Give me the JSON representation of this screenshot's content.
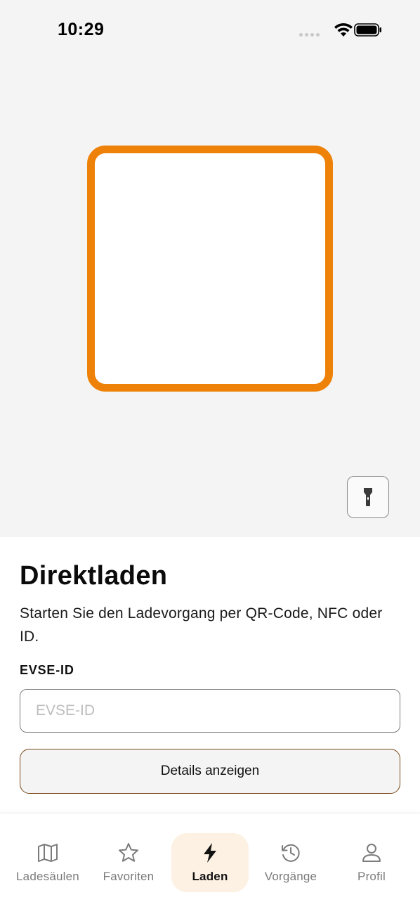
{
  "status_bar": {
    "time": "10:29"
  },
  "scanner": {
    "frame_color": "#ee8208",
    "torch_icon": "flashlight-icon"
  },
  "panel": {
    "title": "Direktladen",
    "subtitle": "Starten Sie den Ladevorgang per QR-Code, NFC oder ID.",
    "evse_label": "EVSE-ID",
    "evse_input": {
      "value": "",
      "placeholder": "EVSE-ID"
    },
    "details_button": "Details anzeigen"
  },
  "tabs": [
    {
      "label": "Ladesäulen",
      "icon": "map-icon",
      "active": false
    },
    {
      "label": "Favoriten",
      "icon": "star-icon",
      "active": false
    },
    {
      "label": "Laden",
      "icon": "bolt-icon",
      "active": true
    },
    {
      "label": "Vorgänge",
      "icon": "history-icon",
      "active": false
    },
    {
      "label": "Profil",
      "icon": "user-icon",
      "active": false
    }
  ],
  "colors": {
    "accent": "#ee8208",
    "active_tab_bg": "#fdf1e3",
    "button_border": "#7a4a1c"
  }
}
